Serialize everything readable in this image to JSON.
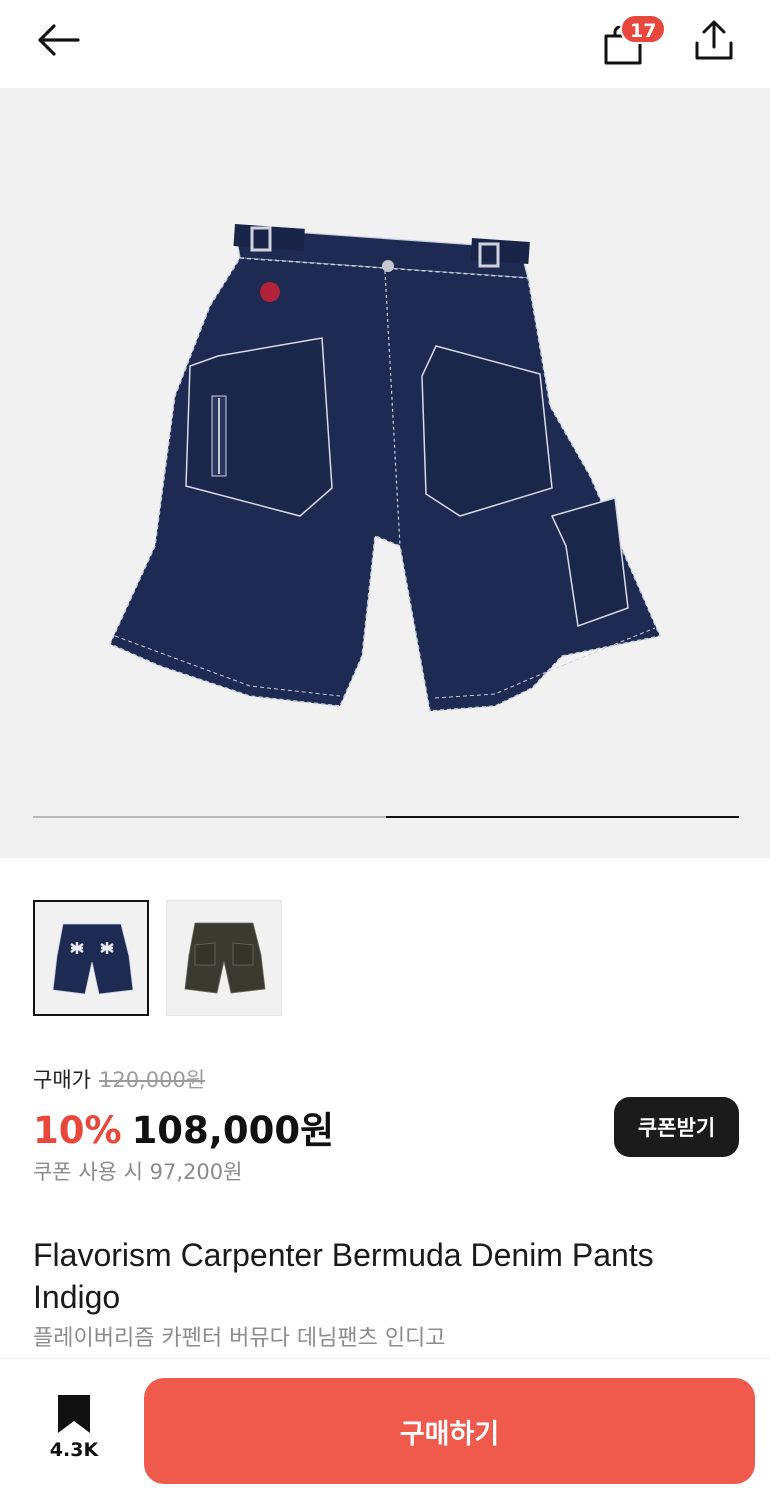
{
  "header": {
    "back_icon": "arrow-left-icon",
    "bag_icon": "shopping-bag-icon",
    "cart_count": "17",
    "share_icon": "share-icon"
  },
  "gallery": {
    "image": "indigo-denim-carpenter-shorts",
    "progress": {
      "segments": 2,
      "current": 2
    },
    "thumbnails": [
      {
        "name": "indigo-shorts-back-with-cross-pockets",
        "selected": true
      },
      {
        "name": "black-washed-shorts",
        "selected": false
      }
    ]
  },
  "price": {
    "label": "구매가",
    "original": "120,000원",
    "discount": "10%",
    "sale": "108,000원",
    "coupon_price": "쿠폰 사용 시 97,200원",
    "coupon_button": "쿠폰받기"
  },
  "product": {
    "name_en": "Flavorism Carpenter Bermuda Denim Pants Indigo",
    "name_ko": "플레이버리즘 카펜터 버뮤다 데님팬츠 인디고"
  },
  "bottom": {
    "bookmark_icon": "bookmark-icon",
    "bookmark_count": "4.3K",
    "buy_label": "구매하기"
  },
  "colors": {
    "accent": "#e8473b",
    "buy_button": "#ef5a4d",
    "hero_bg": "#f1f1f1",
    "denim": "#1e2a52"
  }
}
